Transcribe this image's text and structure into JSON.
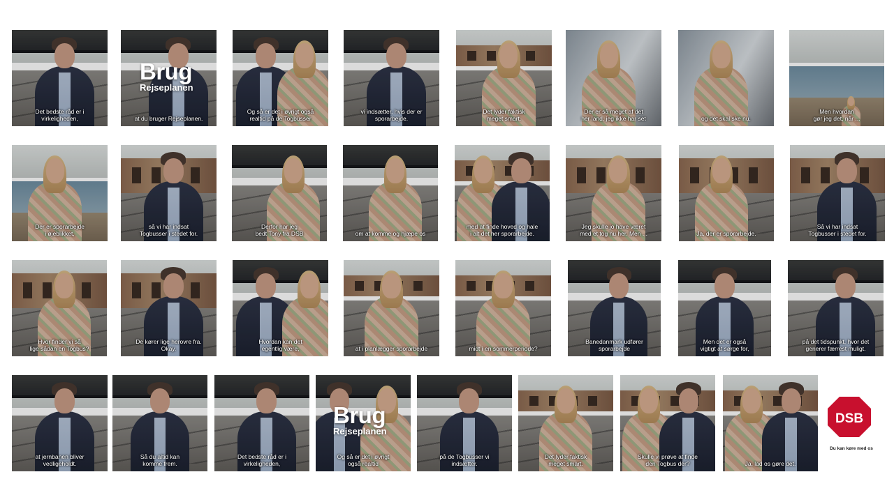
{
  "captions": [
    "Det bedste råd er i\nvirkeligheden,",
    "at du bruger Rejseplanen.",
    "Og så er det i øvrigt også\nrealtid på de Togbusser",
    "vi indsætter, hvis der er\nsporarbejde.",
    "Det lyder faktisk\nmeget smart.",
    "Der er så meget af det\nher land, jeg ikke har set",
    "og det skal ske nu.",
    "Men hvordan\ngør jeg det, når ...",
    "Der er sporarbejde\ni øjeblikket,",
    "så vi har indsat\nTogbusser i stedet for.",
    "Derfor har jeg\nbedt Tony fra DSB",
    "om at komme og hjæpe os",
    "med at finde hoved og hale\ni alt det her sporarbejde.",
    "Jeg skulle jo have været\nmed et tog nu her. Men ...",
    "Ja, der er sporarbejde.",
    "Så vi har indsat\nTogbusser i stedet for.",
    "Hvor finder vi så\nlige sådan en Togbus?",
    "De kører lige herovre fra.\nOkay.",
    "Hvordan kan det\negentlig være,",
    "at i planlægger sporarbejde",
    "midt i en sommerperiode?",
    "Banedanmark udfører\nsporarbejde",
    "Men det er også\nvigtigt at sørge for,",
    "på det tidspunkt, hvor det\ngenerer færrest muligt.",
    "at jernbanen bliver\nvedligeholdt.",
    "Så du altid kan\nkomme frem.",
    "Det bedste råd er i\nvirkeligheden,",
    "Og så er det i øvrigt\nogså realtid",
    "på de Togbusser vi\nindsætter.",
    "Det lyder faktisk\nmeget smart.",
    "Skulle vi prøve at finde\nden Togbus dér?",
    "Ja, lad os gøre det."
  ],
  "overlays": [
    {
      "frame": 2,
      "title": "Brug",
      "subtitle": "Rejseplanen"
    },
    {
      "frame": 28,
      "title": "Brug",
      "subtitle": "Rejseplanen"
    }
  ],
  "logo": {
    "text": "DSB",
    "color": "#c8102e",
    "tagline": "Du kan køre med os"
  },
  "colors": {
    "background": "#ffffff",
    "caption": "#ffffff"
  }
}
